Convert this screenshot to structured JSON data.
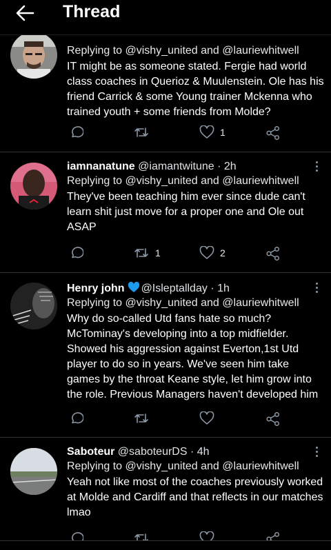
{
  "header": {
    "title": "Thread"
  },
  "tweets": [
    {
      "name": "",
      "handle": "",
      "time": "",
      "reply_prefix": "Replying to ",
      "reply_users": [
        "@vishy_united",
        "@lauriewhitwell"
      ],
      "reply_and": " and ",
      "text": "IT might be as someone stated. Fergie had world class coaches in Querioz & Muulenstein. Ole has his friend Carrick & some Young trainer Mckenna who trained youth + some friends from Molde?",
      "retweets": "",
      "likes": "1"
    },
    {
      "name": "iamnanatune",
      "handle": "@iamantwitune",
      "time": "· 2h",
      "reply_prefix": "Replying to ",
      "reply_users": [
        "@vishy_united",
        "@lauriewhitwell"
      ],
      "reply_and": " and ",
      "text": "They've been teaching him ever since dude can't learn shit just move for a proper one and Ole out ASAP",
      "retweets": "1",
      "likes": "2"
    },
    {
      "name": "Henry john",
      "handle": "@Isleptallday",
      "time": "· 1h",
      "reply_prefix": "Replying to ",
      "reply_users": [
        "@vishy_united",
        "@lauriewhitwell"
      ],
      "reply_and": " and ",
      "text": "Why do so-called Utd fans hate so much? McTominay's developing into a top midfielder. Showed his aggression against Everton,1st Utd player to do so in years. We've seen him take games by the throat Keane style, let him grow into the role. Previous Managers haven't developed him",
      "retweets": "",
      "likes": ""
    },
    {
      "name": "Saboteur",
      "handle": "@saboteurDS",
      "time": "· 4h",
      "reply_prefix": "Replying to ",
      "reply_users": [
        "@vishy_united",
        "@lauriewhitwell"
      ],
      "reply_and": " and ",
      "text": "Yeah not like most of the coaches previously worked at Molde and Cardiff and that reflects in our matches lmao",
      "retweets": "",
      "likes": ""
    }
  ],
  "colors": {
    "background": "#000000",
    "verified": "#1d9bf0",
    "muted": "#8b98a5"
  },
  "icons": [
    "back-arrow-icon",
    "reply-icon",
    "retweet-icon",
    "like-icon",
    "share-icon",
    "more-icon",
    "verified-icon"
  ]
}
